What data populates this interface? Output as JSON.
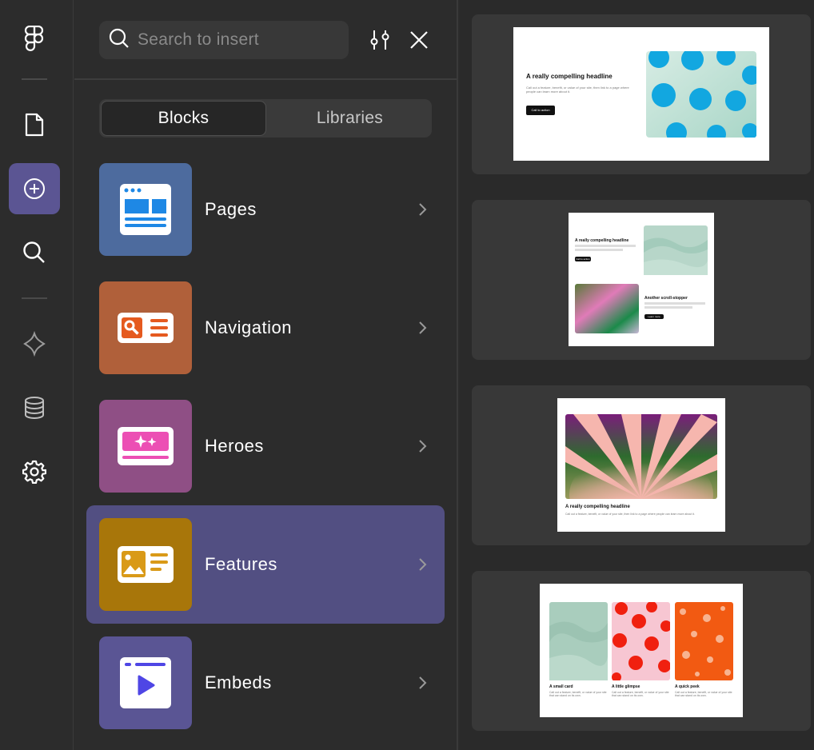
{
  "sidebar_rail": {
    "items": [
      {
        "icon": "figma-logo-icon"
      },
      {
        "icon": "page-icon"
      },
      {
        "icon": "insert-plus-icon",
        "active": true
      },
      {
        "icon": "search-icon"
      },
      {
        "icon": "components-icon"
      },
      {
        "icon": "database-icon"
      },
      {
        "icon": "settings-gear-icon"
      }
    ]
  },
  "search": {
    "placeholder": "Search to insert",
    "value": ""
  },
  "tabs": [
    {
      "label": "Blocks",
      "active": true
    },
    {
      "label": "Libraries",
      "active": false
    }
  ],
  "categories": [
    {
      "label": "Pages",
      "color": "#4d6b9e",
      "icon": "pages-icon"
    },
    {
      "label": "Navigation",
      "color": "#b0603a",
      "icon": "navigation-icon"
    },
    {
      "label": "Heroes",
      "color": "#8f4f85",
      "icon": "heroes-icon"
    },
    {
      "label": "Features",
      "color": "#a8760a",
      "icon": "features-icon",
      "active": true
    },
    {
      "label": "Embeds",
      "color": "#5a5594",
      "icon": "embeds-icon"
    }
  ],
  "previews": [
    {
      "headline": "A really compelling headline",
      "body": "Call out a feature, benefit, or value of your site, then link to a page where people can learn more about it.",
      "button": "Call to action"
    },
    {
      "headline": "A really compelling headline",
      "headline2": "Another scroll-stopper",
      "button": "Call to action",
      "button2": "Learn more"
    },
    {
      "headline": "A really compelling headline",
      "body": "Call out a feature, benefit, or value of your site, then link to a page where people can learn more about it."
    },
    {
      "cards": [
        {
          "title": "A small card",
          "body": "Call out a feature, benefit, or value of your site that can stand on its own."
        },
        {
          "title": "A little glimpse",
          "body": "Call out a feature, benefit, or value of your site that can stand on its own."
        },
        {
          "title": "A quick peek",
          "body": "Call out a feature, benefit, or value of your site that can stand on its own."
        }
      ]
    }
  ],
  "colors": {
    "accent": "#5b5593",
    "selected_row": "#524f82",
    "background": "#2c2c2c"
  }
}
